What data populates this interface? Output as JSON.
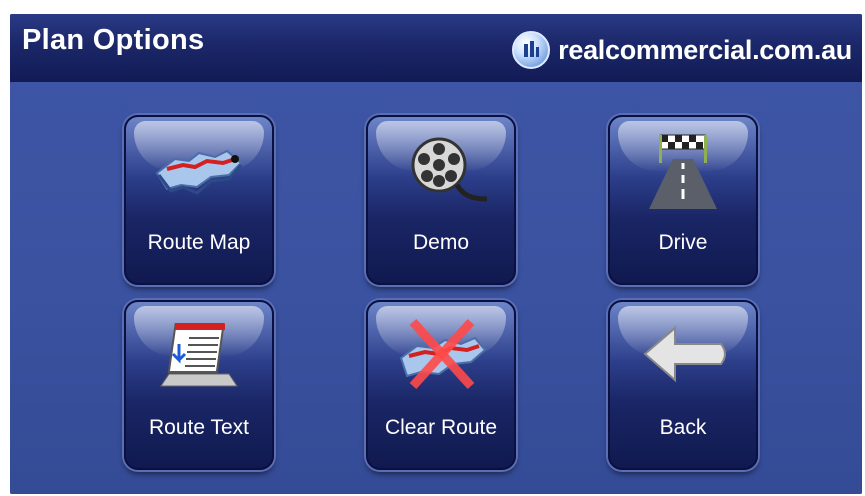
{
  "header": {
    "title": "Plan Options",
    "brand": "realcommercial.com.au"
  },
  "buttons": [
    {
      "label": "Route Map",
      "icon": "route-map-icon"
    },
    {
      "label": "Demo",
      "icon": "film-reel-icon"
    },
    {
      "label": "Drive",
      "icon": "road-flag-icon"
    },
    {
      "label": "Route Text",
      "icon": "route-text-icon"
    },
    {
      "label": "Clear Route",
      "icon": "clear-route-icon"
    },
    {
      "label": "Back",
      "icon": "back-arrow-icon"
    }
  ],
  "colors": {
    "header_bg": "#1b2768",
    "body_bg": "#3a52a0",
    "button_dark": "#1a2666",
    "text": "#ffffff"
  }
}
